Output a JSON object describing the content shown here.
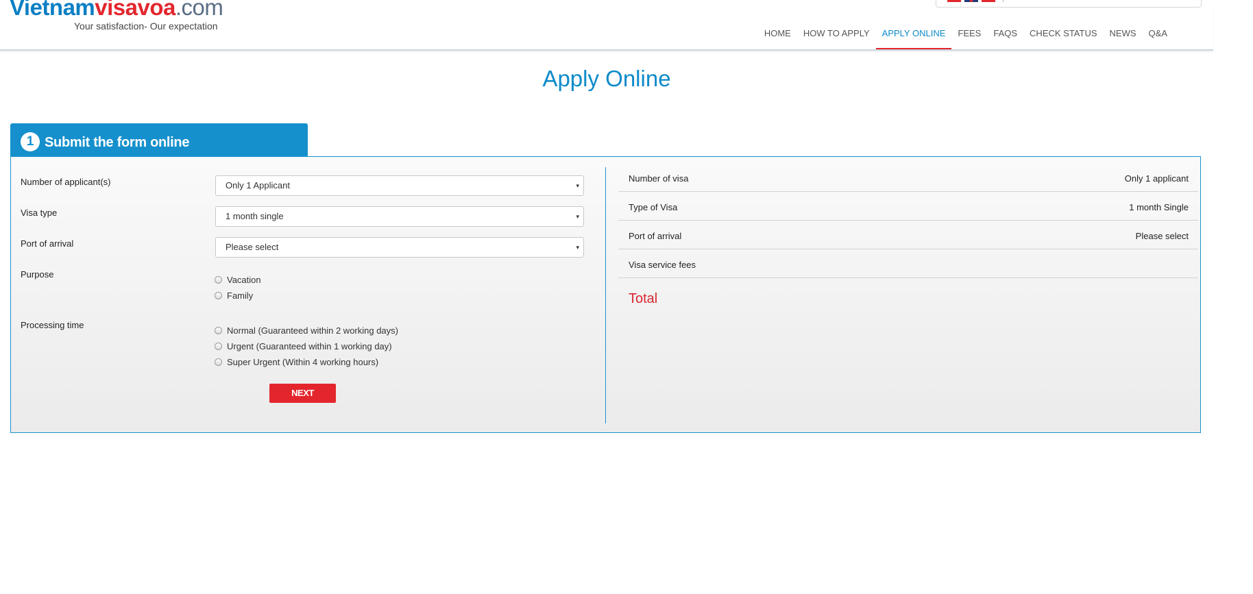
{
  "header": {
    "logo": {
      "part1": "Vietnam",
      "part2": "visavoa",
      "part3": ".com"
    },
    "tagline": "Your satisfaction- Our expectation",
    "flags": [
      "vietnam-flag-icon",
      "uk-flag-icon",
      "china-flag-icon"
    ],
    "nav": [
      {
        "label": "HOME",
        "active": false
      },
      {
        "label": "HOW TO APPLY",
        "active": false
      },
      {
        "label": "APPLY ONLINE",
        "active": true
      },
      {
        "label": "FEES",
        "active": false
      },
      {
        "label": "FAQS",
        "active": false
      },
      {
        "label": "CHECK STATUS",
        "active": false
      },
      {
        "label": "NEWS",
        "active": false
      },
      {
        "label": "Q&A",
        "active": false
      }
    ]
  },
  "page_title": "Apply Online",
  "step": {
    "number": "1",
    "label": "Submit the form online"
  },
  "form": {
    "applicants": {
      "label": "Number of applicant(s)",
      "value": "Only 1 Applicant"
    },
    "visa_type": {
      "label": "Visa type",
      "value": "1 month single"
    },
    "port": {
      "label": "Port of arrival",
      "value": "Please select"
    },
    "purpose": {
      "label": "Purpose",
      "options": [
        "Vacation",
        "Family"
      ]
    },
    "processing": {
      "label": "Processing time",
      "options": [
        "Normal (Guaranteed within 2 working days)",
        "Urgent (Guaranteed within 1 working day)",
        "Super Urgent (Within 4 working hours)"
      ]
    },
    "next_label": "NEXT",
    "dropdown_arrow": "▾"
  },
  "summary": {
    "rows": [
      {
        "key": "Number of visa",
        "value": "Only 1 applicant"
      },
      {
        "key": "Type of Visa",
        "value": "1 month Single"
      },
      {
        "key": "Port of arrival",
        "value": "Please select"
      },
      {
        "key": "Visa service fees",
        "value": ""
      }
    ],
    "total_label": "Total"
  },
  "colors": {
    "brand_blue": "#0b8ac9",
    "brand_red": "#e3262d",
    "panel_border": "#1a92cc"
  }
}
